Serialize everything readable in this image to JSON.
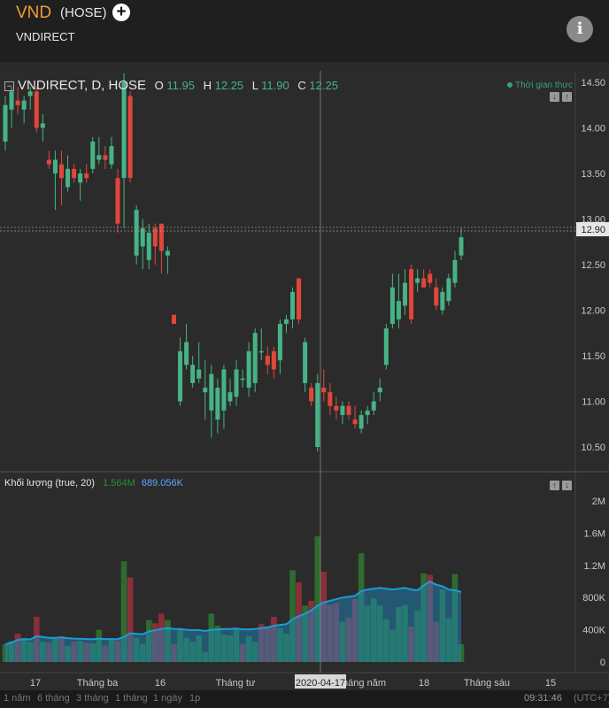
{
  "header": {
    "ticker": "VND",
    "exchange": "(HOSE)",
    "company": "VNDIRECT"
  },
  "legend": {
    "title": "VNDIRECT, D, HOSE",
    "o_label": "O",
    "o_value": "11.95",
    "h_label": "H",
    "h_value": "12.25",
    "l_label": "L",
    "l_value": "11.90",
    "c_label": "C",
    "c_value": "12.25",
    "status": "Thời gian thực"
  },
  "volume_legend": {
    "title": "Khối lượng (true, 20)",
    "vol": "1.564M",
    "ma": "689.056K"
  },
  "crosshair": {
    "date_label": "2020-04-17",
    "price_label": "12.90"
  },
  "bottom_bar": {
    "ranges": [
      "1 năm",
      "6 tháng",
      "3 tháng",
      "1 tháng",
      "1 ngày",
      "1p"
    ],
    "clock": "09:31:46",
    "timezone": "(UTC+7)"
  },
  "colors": {
    "up": "#46b386",
    "down": "#e2463a",
    "vol_up": "#2f6b2f",
    "vol_down": "#8a2f3a",
    "ma_line": "#1c9bd8"
  },
  "chart_data": [
    {
      "type": "candlestick",
      "y_ticks": [
        "14.50",
        "14.00",
        "13.50",
        "13.00",
        "12.50",
        "12.00",
        "11.50",
        "11.00",
        "10.50"
      ],
      "ylim": [
        10.27,
        14.78
      ],
      "x_ticks": [
        "17",
        "Tháng ba",
        "16",
        "Tháng tư",
        "tháng năm",
        "18",
        "Tháng sáu",
        "15"
      ],
      "candles": [
        {
          "o": 13.85,
          "h": 14.35,
          "l": 13.75,
          "c": 14.25
        },
        {
          "o": 14.2,
          "h": 14.45,
          "l": 14.0,
          "c": 14.4
        },
        {
          "o": 14.3,
          "h": 14.45,
          "l": 14.15,
          "c": 14.25
        },
        {
          "o": 14.2,
          "h": 14.35,
          "l": 14.05,
          "c": 14.3
        },
        {
          "o": 14.35,
          "h": 14.45,
          "l": 14.2,
          "c": 14.4
        },
        {
          "o": 14.4,
          "h": 14.45,
          "l": 13.95,
          "c": 14.0
        },
        {
          "o": 14.0,
          "h": 14.15,
          "l": 13.85,
          "c": 14.05
        },
        {
          "o": 13.65,
          "h": 13.75,
          "l": 13.55,
          "c": 13.6
        },
        {
          "o": 13.5,
          "h": 13.75,
          "l": 13.1,
          "c": 13.65
        },
        {
          "o": 13.6,
          "h": 13.75,
          "l": 13.15,
          "c": 13.45
        },
        {
          "o": 13.35,
          "h": 13.7,
          "l": 13.3,
          "c": 13.55
        },
        {
          "o": 13.55,
          "h": 13.6,
          "l": 13.4,
          "c": 13.45
        },
        {
          "o": 13.4,
          "h": 13.55,
          "l": 13.2,
          "c": 13.5
        },
        {
          "o": 13.5,
          "h": 13.6,
          "l": 13.4,
          "c": 13.45
        },
        {
          "o": 13.55,
          "h": 13.9,
          "l": 13.5,
          "c": 13.85
        },
        {
          "o": 13.65,
          "h": 13.9,
          "l": 13.6,
          "c": 13.7
        },
        {
          "o": 13.7,
          "h": 13.8,
          "l": 13.55,
          "c": 13.65
        },
        {
          "o": 13.6,
          "h": 13.9,
          "l": 13.55,
          "c": 13.8
        },
        {
          "o": 13.45,
          "h": 13.55,
          "l": 12.85,
          "c": 12.95
        },
        {
          "o": 13.45,
          "h": 14.6,
          "l": 12.9,
          "c": 14.5
        },
        {
          "o": 14.35,
          "h": 14.4,
          "l": 13.4,
          "c": 13.45
        },
        {
          "o": 12.6,
          "h": 13.15,
          "l": 12.5,
          "c": 13.1
        },
        {
          "o": 12.7,
          "h": 13.0,
          "l": 12.45,
          "c": 12.9
        },
        {
          "o": 12.55,
          "h": 12.95,
          "l": 12.45,
          "c": 12.85
        },
        {
          "o": 12.9,
          "h": 12.95,
          "l": 12.5,
          "c": 12.7
        },
        {
          "o": 12.95,
          "h": 12.95,
          "l": 12.4,
          "c": 12.65
        },
        {
          "o": 12.6,
          "h": 12.7,
          "l": 12.4,
          "c": 12.65
        },
        {
          "o": 11.95,
          "h": 11.95,
          "l": 11.85,
          "c": 11.85
        },
        {
          "o": 11.0,
          "h": 11.7,
          "l": 10.95,
          "c": 11.55
        },
        {
          "o": 11.4,
          "h": 11.85,
          "l": 11.35,
          "c": 11.65
        },
        {
          "o": 11.2,
          "h": 11.5,
          "l": 11.15,
          "c": 11.4
        },
        {
          "o": 11.25,
          "h": 11.65,
          "l": 11.2,
          "c": 11.35
        },
        {
          "o": 11.1,
          "h": 11.45,
          "l": 10.8,
          "c": 11.15
        },
        {
          "o": 10.9,
          "h": 11.4,
          "l": 10.6,
          "c": 11.3
        },
        {
          "o": 10.8,
          "h": 11.25,
          "l": 10.65,
          "c": 11.15
        },
        {
          "o": 10.9,
          "h": 11.4,
          "l": 10.7,
          "c": 11.35
        },
        {
          "o": 11.0,
          "h": 11.25,
          "l": 10.95,
          "c": 11.1
        },
        {
          "o": 11.05,
          "h": 11.45,
          "l": 10.95,
          "c": 11.35
        },
        {
          "o": 11.25,
          "h": 11.35,
          "l": 11.15,
          "c": 11.25
        },
        {
          "o": 11.15,
          "h": 11.65,
          "l": 11.05,
          "c": 11.55
        },
        {
          "o": 11.2,
          "h": 11.8,
          "l": 11.1,
          "c": 11.75
        },
        {
          "o": 11.55,
          "h": 11.8,
          "l": 11.45,
          "c": 11.55
        },
        {
          "o": 11.5,
          "h": 11.6,
          "l": 11.3,
          "c": 11.4
        },
        {
          "o": 11.55,
          "h": 11.6,
          "l": 11.25,
          "c": 11.35
        },
        {
          "o": 11.45,
          "h": 11.9,
          "l": 11.3,
          "c": 11.85
        },
        {
          "o": 11.85,
          "h": 11.95,
          "l": 11.75,
          "c": 11.9
        },
        {
          "o": 11.9,
          "h": 12.25,
          "l": 11.8,
          "c": 12.2
        },
        {
          "o": 12.35,
          "h": 12.35,
          "l": 11.85,
          "c": 11.9
        },
        {
          "o": 11.2,
          "h": 11.7,
          "l": 11.1,
          "c": 11.65
        },
        {
          "o": 11.15,
          "h": 11.2,
          "l": 10.95,
          "c": 11.0
        },
        {
          "o": 10.5,
          "h": 11.3,
          "l": 10.45,
          "c": 11.2
        },
        {
          "o": 11.15,
          "h": 11.35,
          "l": 11.0,
          "c": 11.1
        },
        {
          "o": 11.1,
          "h": 11.2,
          "l": 10.85,
          "c": 10.95
        },
        {
          "o": 10.95,
          "h": 11.05,
          "l": 10.8,
          "c": 10.9
        },
        {
          "o": 10.85,
          "h": 11.0,
          "l": 10.75,
          "c": 10.95
        },
        {
          "o": 10.95,
          "h": 11.0,
          "l": 10.8,
          "c": 10.85
        },
        {
          "o": 10.8,
          "h": 10.95,
          "l": 10.7,
          "c": 10.75
        },
        {
          "o": 10.7,
          "h": 10.9,
          "l": 10.65,
          "c": 10.85
        },
        {
          "o": 10.85,
          "h": 10.95,
          "l": 10.75,
          "c": 10.9
        },
        {
          "o": 10.9,
          "h": 11.1,
          "l": 10.85,
          "c": 11.0
        },
        {
          "o": 11.1,
          "h": 11.25,
          "l": 11.0,
          "c": 11.15
        },
        {
          "o": 11.4,
          "h": 11.85,
          "l": 11.35,
          "c": 11.8
        },
        {
          "o": 11.85,
          "h": 12.4,
          "l": 11.8,
          "c": 12.25
        },
        {
          "o": 11.9,
          "h": 12.4,
          "l": 11.8,
          "c": 12.1
        },
        {
          "o": 12.05,
          "h": 12.45,
          "l": 11.95,
          "c": 12.3
        },
        {
          "o": 12.45,
          "h": 12.5,
          "l": 11.85,
          "c": 11.9
        },
        {
          "o": 12.3,
          "h": 12.45,
          "l": 12.2,
          "c": 12.35
        },
        {
          "o": 12.35,
          "h": 12.45,
          "l": 12.25,
          "c": 12.25
        },
        {
          "o": 12.4,
          "h": 12.45,
          "l": 12.25,
          "c": 12.3
        },
        {
          "o": 12.25,
          "h": 12.35,
          "l": 12.0,
          "c": 12.05
        },
        {
          "o": 12.0,
          "h": 12.25,
          "l": 11.95,
          "c": 12.2
        },
        {
          "o": 12.1,
          "h": 12.4,
          "l": 12.05,
          "c": 12.35
        },
        {
          "o": 12.3,
          "h": 12.65,
          "l": 12.25,
          "c": 12.55
        },
        {
          "o": 12.6,
          "h": 12.9,
          "l": 12.55,
          "c": 12.8
        }
      ]
    },
    {
      "type": "bar",
      "series_name": "Khối lượng",
      "y_ticks": [
        "2M",
        "1.6M",
        "1.2M",
        "800K",
        "400K",
        "0"
      ],
      "ylim": [
        0,
        2000000
      ],
      "values": [
        220000,
        260000,
        350000,
        300000,
        250000,
        560000,
        250000,
        240000,
        290000,
        320000,
        200000,
        250000,
        260000,
        240000,
        230000,
        400000,
        200000,
        280000,
        260000,
        1250000,
        1050000,
        300000,
        220000,
        520000,
        480000,
        600000,
        520000,
        220000,
        400000,
        300000,
        250000,
        330000,
        120000,
        600000,
        450000,
        340000,
        330000,
        410000,
        220000,
        320000,
        250000,
        470000,
        440000,
        560000,
        420000,
        350000,
        1140000,
        990000,
        700000,
        760000,
        1560000,
        1120000,
        710000,
        730000,
        500000,
        550000,
        780000,
        1350000,
        700000,
        790000,
        700000,
        530000,
        400000,
        680000,
        710000,
        440000,
        640000,
        1100000,
        1080000,
        500000,
        900000,
        540000,
        1090000,
        220000
      ],
      "ma_values": [
        220000,
        240000,
        275000,
        283000,
        280000,
        320000,
        310000,
        300000,
        300000,
        305000,
        295000,
        290000,
        288000,
        285000,
        282000,
        290000,
        285000,
        285000,
        283000,
        312000,
        355000,
        350000,
        345000,
        380000,
        395000,
        410000,
        420000,
        410000,
        410000,
        400000,
        395000,
        395000,
        385000,
        400000,
        405000,
        410000,
        410000,
        415000,
        405000,
        405000,
        410000,
        420000,
        430000,
        450000,
        460000,
        470000,
        530000,
        570000,
        600000,
        640000,
        700000,
        740000,
        760000,
        780000,
        800000,
        810000,
        820000,
        880000,
        900000,
        910000,
        920000,
        910000,
        900000,
        910000,
        920000,
        900000,
        890000,
        950000,
        1000000,
        960000,
        940000,
        900000,
        890000,
        870000
      ],
      "up": [
        true,
        true,
        false,
        true,
        true,
        false,
        true,
        false,
        true,
        false,
        true,
        false,
        true,
        false,
        true,
        true,
        false,
        true,
        false,
        true,
        false,
        true,
        true,
        true,
        false,
        false,
        true,
        false,
        true,
        true,
        true,
        true,
        true,
        true,
        true,
        true,
        true,
        true,
        false,
        true,
        true,
        false,
        false,
        false,
        true,
        true,
        true,
        false,
        true,
        false,
        true,
        false,
        false,
        false,
        true,
        false,
        false,
        true,
        true,
        true,
        true,
        true,
        true,
        true,
        true,
        false,
        true,
        true,
        false,
        false,
        true,
        true,
        true,
        true
      ]
    }
  ]
}
